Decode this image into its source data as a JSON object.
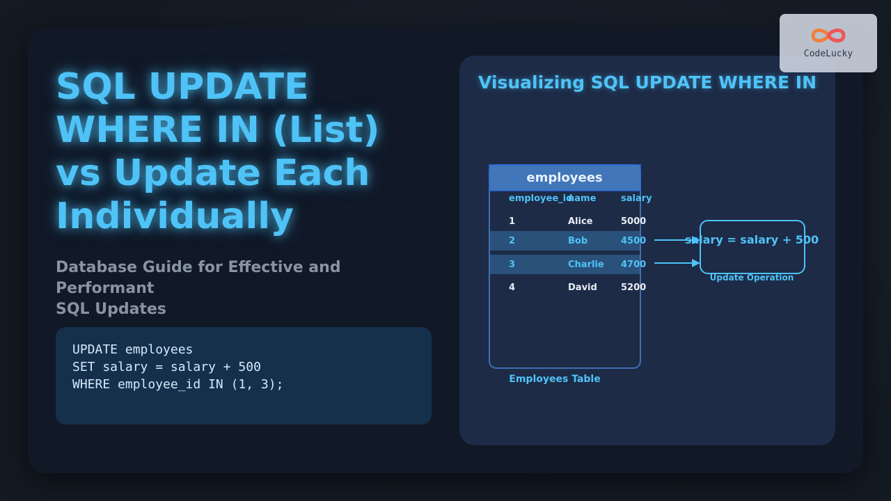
{
  "hero": {
    "title_lines": [
      "SQL UPDATE",
      "WHERE IN (List)",
      "vs Update Each",
      "Individually"
    ],
    "subtitle_lines": [
      "Database Guide for Effective and Performant",
      "SQL Updates"
    ]
  },
  "code": {
    "lines": [
      "UPDATE employees",
      "SET salary = salary + 500",
      "WHERE employee_id IN (1, 3);"
    ]
  },
  "viz": {
    "title": "Visualizing SQL UPDATE WHERE IN",
    "table": {
      "name": "employees",
      "caption": "Employees Table",
      "columns": [
        "employee_id",
        "name",
        "salary"
      ],
      "rows": [
        [
          "1",
          "Alice",
          "5000"
        ],
        [
          "2",
          "Bob",
          "4500"
        ],
        [
          "3",
          "Charlie",
          "4700"
        ],
        [
          "4",
          "David",
          "5200"
        ]
      ],
      "highlighted_rows": [
        1,
        2
      ]
    },
    "operation": {
      "expression": "salary = salary + 500",
      "label": "Update Operation"
    }
  },
  "logo": {
    "text": "CodeLucky"
  },
  "colors": {
    "accent": "#4fc3f7",
    "table_header": "#4176b8",
    "table_border": "#3f6fb5",
    "highlight_row": "#29517a",
    "highlight_text": "#4fc3f7"
  }
}
